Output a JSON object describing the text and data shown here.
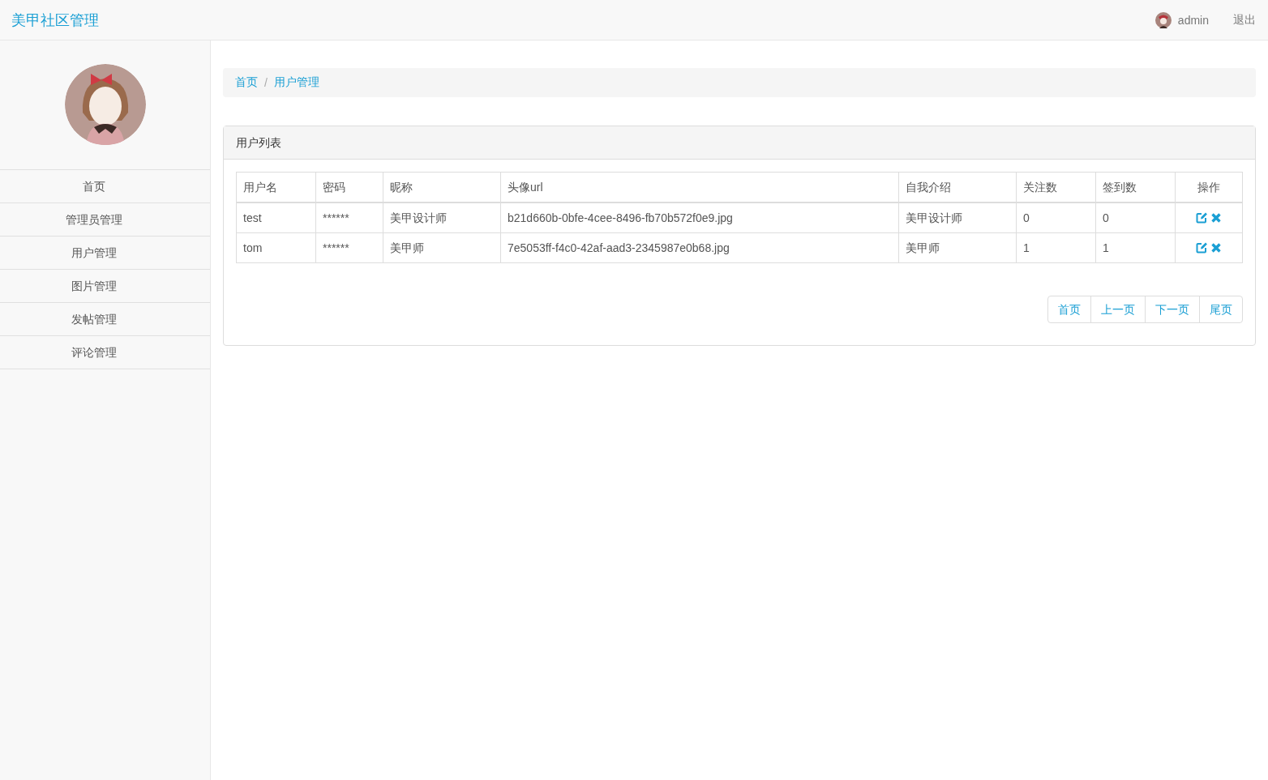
{
  "navbar": {
    "brand": "美甲社区管理",
    "user": "admin",
    "logout": "退出"
  },
  "sidebar": {
    "items": [
      {
        "label": "首页"
      },
      {
        "label": "管理员管理"
      },
      {
        "label": "用户管理"
      },
      {
        "label": "图片管理"
      },
      {
        "label": "发帖管理"
      },
      {
        "label": "评论管理"
      }
    ]
  },
  "breadcrumb": {
    "separator": "/",
    "items": [
      {
        "label": "首页"
      },
      {
        "label": "用户管理"
      }
    ]
  },
  "panel": {
    "title": "用户列表",
    "table": {
      "columns": [
        "用户名",
        "密码",
        "昵称",
        "头像url",
        "自我介绍",
        "关注数",
        "签到数",
        "操作"
      ],
      "rows": [
        [
          "test",
          "******",
          "美甲设计师",
          "b21d660b-0bfe-4cee-8496-fb70b572f0e9.jpg",
          "美甲设计师",
          "0",
          "0"
        ],
        [
          "tom",
          "******",
          "美甲师",
          "7e5053ff-f4c0-42af-aad3-2345987e0b68.jpg",
          "美甲师",
          "1",
          "1"
        ]
      ]
    },
    "pagination": [
      "首页",
      "上一页",
      "下一页",
      "尾页"
    ]
  }
}
